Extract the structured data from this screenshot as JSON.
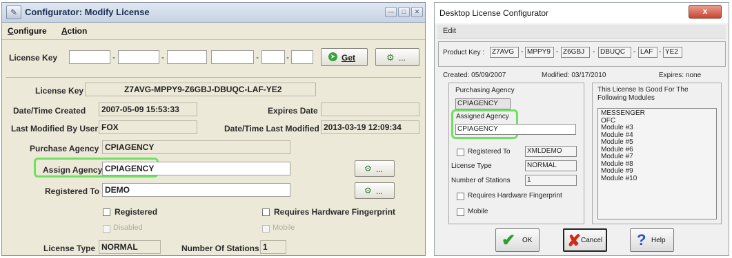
{
  "left_window": {
    "title": "Configurator: Modify License",
    "menu": [
      "Configure",
      "Action"
    ],
    "license_key_label": "License Key",
    "key_separator": "-",
    "get_button": "Get",
    "lookup_button": "...",
    "fields": {
      "license_key_label": "License Key",
      "license_key_value": "Z7AVG-MPPY9-Z6GBJ-DBUQC-LAF-YE2",
      "date_created_label": "Date/Time Created",
      "date_created_value": "2007-05-09 15:53:33",
      "expires_label": "Expires Date",
      "expires_value": "",
      "last_modified_by_label": "Last Modified By User",
      "last_modified_by_value": "FOX",
      "last_modified_label": "Date/Time Last Modified",
      "last_modified_value": "2013-03-19 12:09:34",
      "purchase_agency_label": "Purchase Agency",
      "purchase_agency_value": "CPIAGENCY",
      "assign_agency_label": "Assign Agency",
      "assign_agency_value": "CPIAGENCY",
      "registered_to_label": "Registered To",
      "registered_to_value": "DEMO",
      "registered_label": "Registered",
      "requires_fp_label": "Requires Hardware Fingerprint",
      "disabled_label": "Disabled",
      "mobile_label": "Mobile",
      "license_type_label": "License Type",
      "license_type_value": "NORMAL",
      "stations_label": "Number Of Stations",
      "stations_value": "1"
    }
  },
  "right_window": {
    "title": "Desktop License Configurator",
    "close_glyph": "x",
    "menu": [
      "Edit"
    ],
    "product_key_label": "Product Key :",
    "product_key_parts": [
      "Z7AVG",
      "MPPY9",
      "Z6GBJ",
      "DBUQC",
      "LAF",
      "YE2"
    ],
    "key_dash": "-",
    "created": "Created: 05/09/2007",
    "modified": "Modified: 03/17/2010",
    "expires": "Expires: none",
    "purchasing_agency_label": "Purchasing Agency",
    "purchasing_agency_value": "CPIAGENCY",
    "assigned_agency_label": "Assigned Agency",
    "assigned_agency_value": "CPIAGENCY",
    "registered_to_label": "Registered To",
    "registered_to_value": "XMLDEMO",
    "license_type_label": "License Type",
    "license_type_value": "NORMAL",
    "stations_label": "Number of Stations",
    "stations_value": "1",
    "requires_fp_label": "Requires Hardware Fingerprint",
    "mobile_label": "Mobile",
    "modules_heading": "This License Is Good For The Following Modules",
    "modules": [
      "MESSENGER",
      "OFC",
      "Module #3",
      "Module #4",
      "Module #5",
      "Module #6",
      "Module #7",
      "Module #8",
      "Module #9",
      "Module #10"
    ],
    "ok_button": "OK",
    "cancel_button": "Cancel",
    "help_button": "Help"
  },
  "colors": {
    "highlight": "#6fe060",
    "titlebar": "#c7d3e4",
    "close": "#c8452f"
  }
}
